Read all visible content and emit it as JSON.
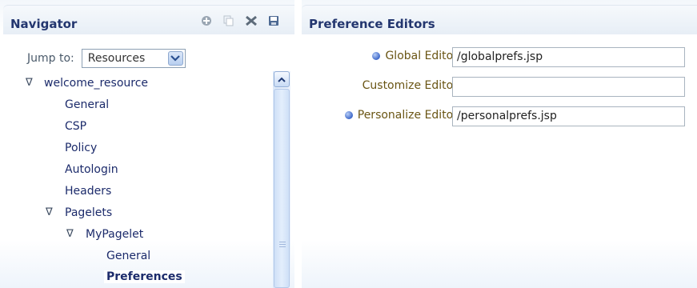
{
  "navigator": {
    "title": "Navigator",
    "toolbar": [
      {
        "icon": "add-icon"
      },
      {
        "icon": "copy-icon"
      },
      {
        "icon": "delete-icon"
      },
      {
        "icon": "save-icon"
      }
    ],
    "jump_label": "Jump to:",
    "jump_value": "Resources",
    "tree": [
      {
        "label": "welcome_resource",
        "expanded": true
      },
      {
        "label": "General"
      },
      {
        "label": "CSP"
      },
      {
        "label": "Policy"
      },
      {
        "label": "Autologin"
      },
      {
        "label": "Headers"
      },
      {
        "label": "Pagelets",
        "expanded": true
      },
      {
        "label": "MyPagelet",
        "expanded": true
      },
      {
        "label": "General"
      },
      {
        "label": "Preferences",
        "selected": true
      }
    ]
  },
  "editors": {
    "title": "Preference Editors",
    "fields": [
      {
        "label": "Global Editor",
        "value": "/globalprefs.jsp",
        "required": true
      },
      {
        "label": "Customize Editor",
        "value": "",
        "required": false
      },
      {
        "label": "Personalize Editor",
        "value": "/personalprefs.jsp",
        "required": true
      }
    ]
  },
  "colors": {
    "header_text": "#23366f",
    "link_text": "#1c2b6b",
    "label_text": "#6a5514",
    "required_dot": "#3d67c9"
  }
}
